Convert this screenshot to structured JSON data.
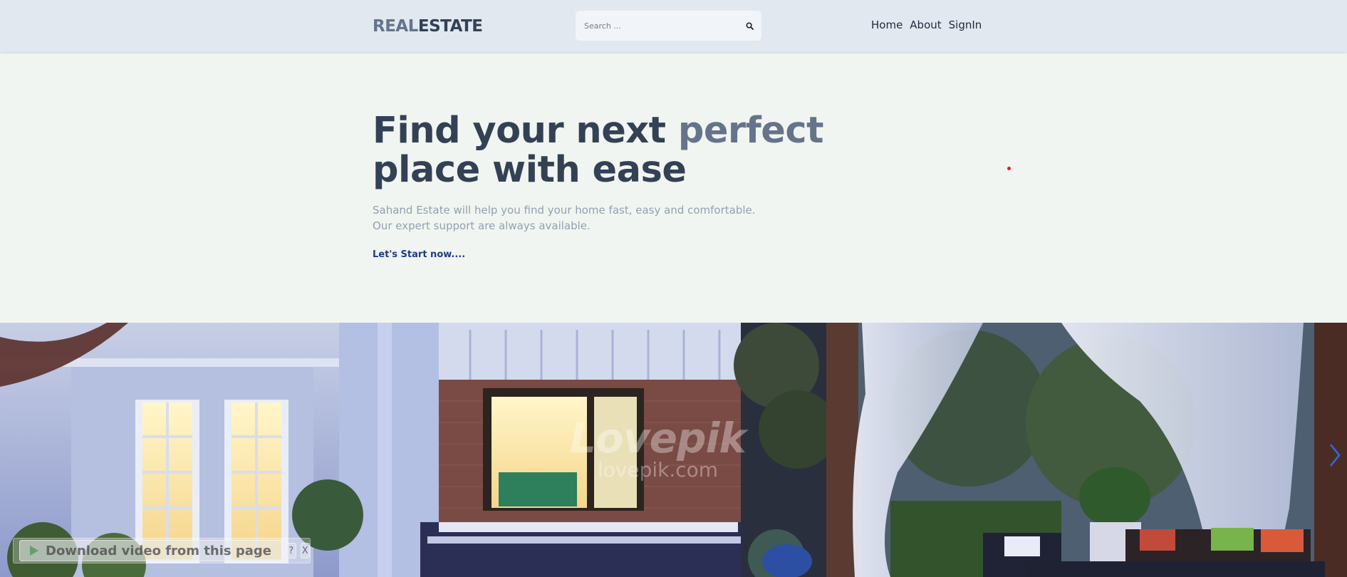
{
  "header": {
    "logo_part1": "REAL",
    "logo_part2": "ESTATE",
    "search_placeholder": "Search ...",
    "search_icon": "search-icon",
    "nav": [
      "Home",
      "About",
      "SignIn"
    ]
  },
  "hero": {
    "title_part1": "Find your next ",
    "title_accent": "perfect",
    "title_part2": "place with ease",
    "subtitle_line1": "Sahand Estate will help you find your home fast, easy and comfortable.",
    "subtitle_line2": "Our expert support are always available.",
    "cta": "Let's Start now...."
  },
  "banner": {
    "watermark_big": "Lovepik",
    "watermark_small": "lovepik.com",
    "next_icon": "chevron-right-icon"
  },
  "download_overlay": {
    "label": "Download video from this page",
    "help": "?",
    "close": "X"
  },
  "colors": {
    "header_bg": "#e2e8f0",
    "page_bg": "#f1f5f1",
    "title": "#334155",
    "accent": "#64748b",
    "cta": "#1e3a8a"
  }
}
